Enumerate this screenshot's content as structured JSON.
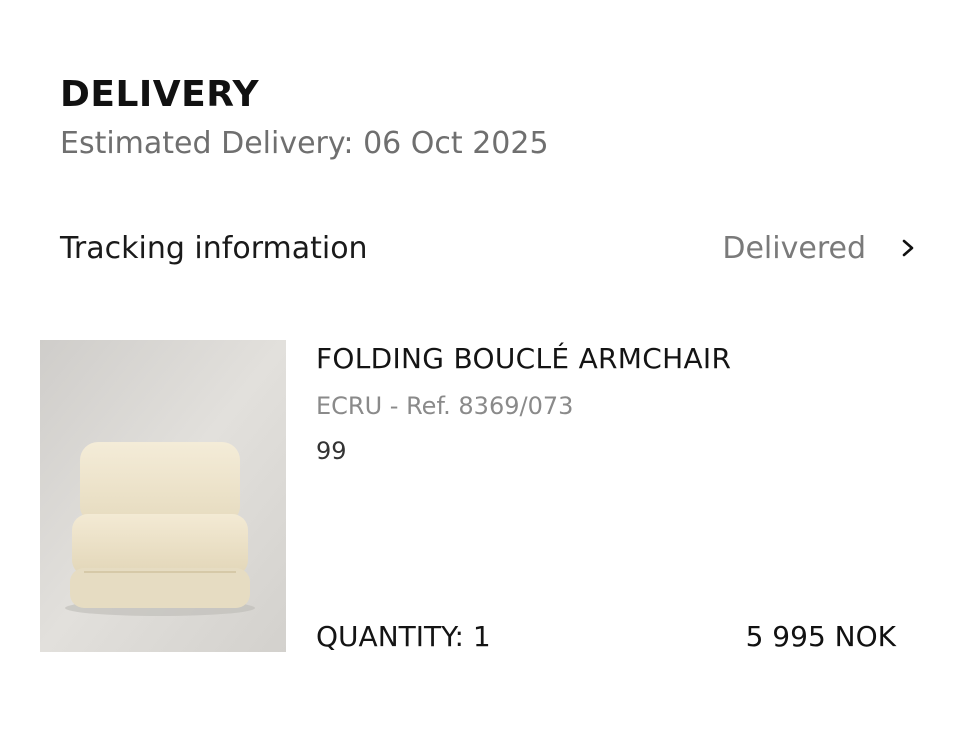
{
  "delivery": {
    "title": "DELIVERY",
    "estimated": "Estimated Delivery: 06 Oct 2025"
  },
  "tracking": {
    "label": "Tracking information",
    "status": "Delivered",
    "icon": "chevron-right-icon"
  },
  "product": {
    "name": "FOLDING BOUCLÉ ARMCHAIR",
    "variant": "ECRU - Ref. 8369/073",
    "code": "99",
    "quantity": "QUANTITY: 1",
    "price": "5 995 NOK",
    "image": "beige-boucle-armchair-photo"
  },
  "colors": {
    "text_primary": "#111111",
    "text_secondary": "#6f6f6f",
    "image_background": "#d8d6d3",
    "chair": "#efe6cf"
  }
}
